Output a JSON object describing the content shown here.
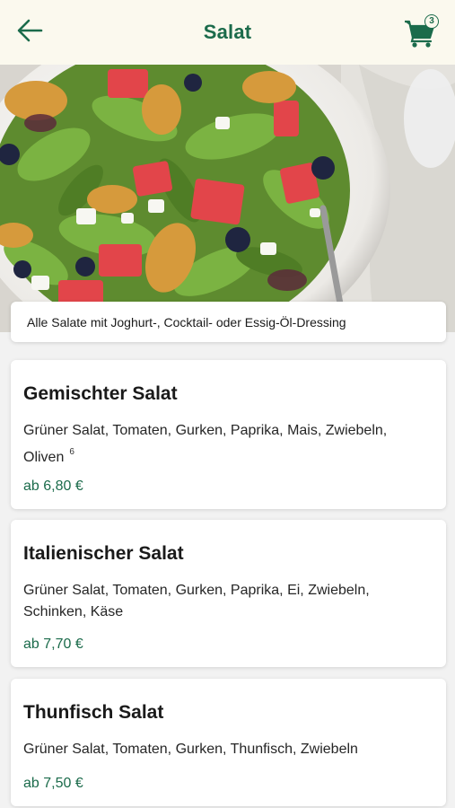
{
  "header": {
    "title": "Salat",
    "cart_count": "3",
    "back_icon": "arrow-left-icon",
    "cart_icon": "shopping-cart-icon"
  },
  "info": {
    "text": "Alle Salate mit Joghurt-, Cocktail- oder Essig-Öl-Dressing"
  },
  "products": [
    {
      "name": "Gemischter Salat",
      "description": "Grüner Salat, Tomaten, Gurken, Paprika, Mais, Zwiebeln, Oliven",
      "footnote": "6",
      "price": "ab 6,80 €"
    },
    {
      "name": "Italienischer Salat",
      "description": "Grüner Salat, Tomaten, Gurken, Paprika, Ei, Zwiebeln, Schinken, Käse",
      "price": "ab 7,70 €"
    },
    {
      "name": "Thunfisch Salat",
      "description": "Grüner Salat, Tomaten, Gurken, Thunfisch, Zwiebeln",
      "price": "ab 7,50 €"
    }
  ],
  "colors": {
    "accent": "#1b6b4b",
    "header_bg": "#fbf9ee",
    "page_bg": "#f2f2f2"
  }
}
